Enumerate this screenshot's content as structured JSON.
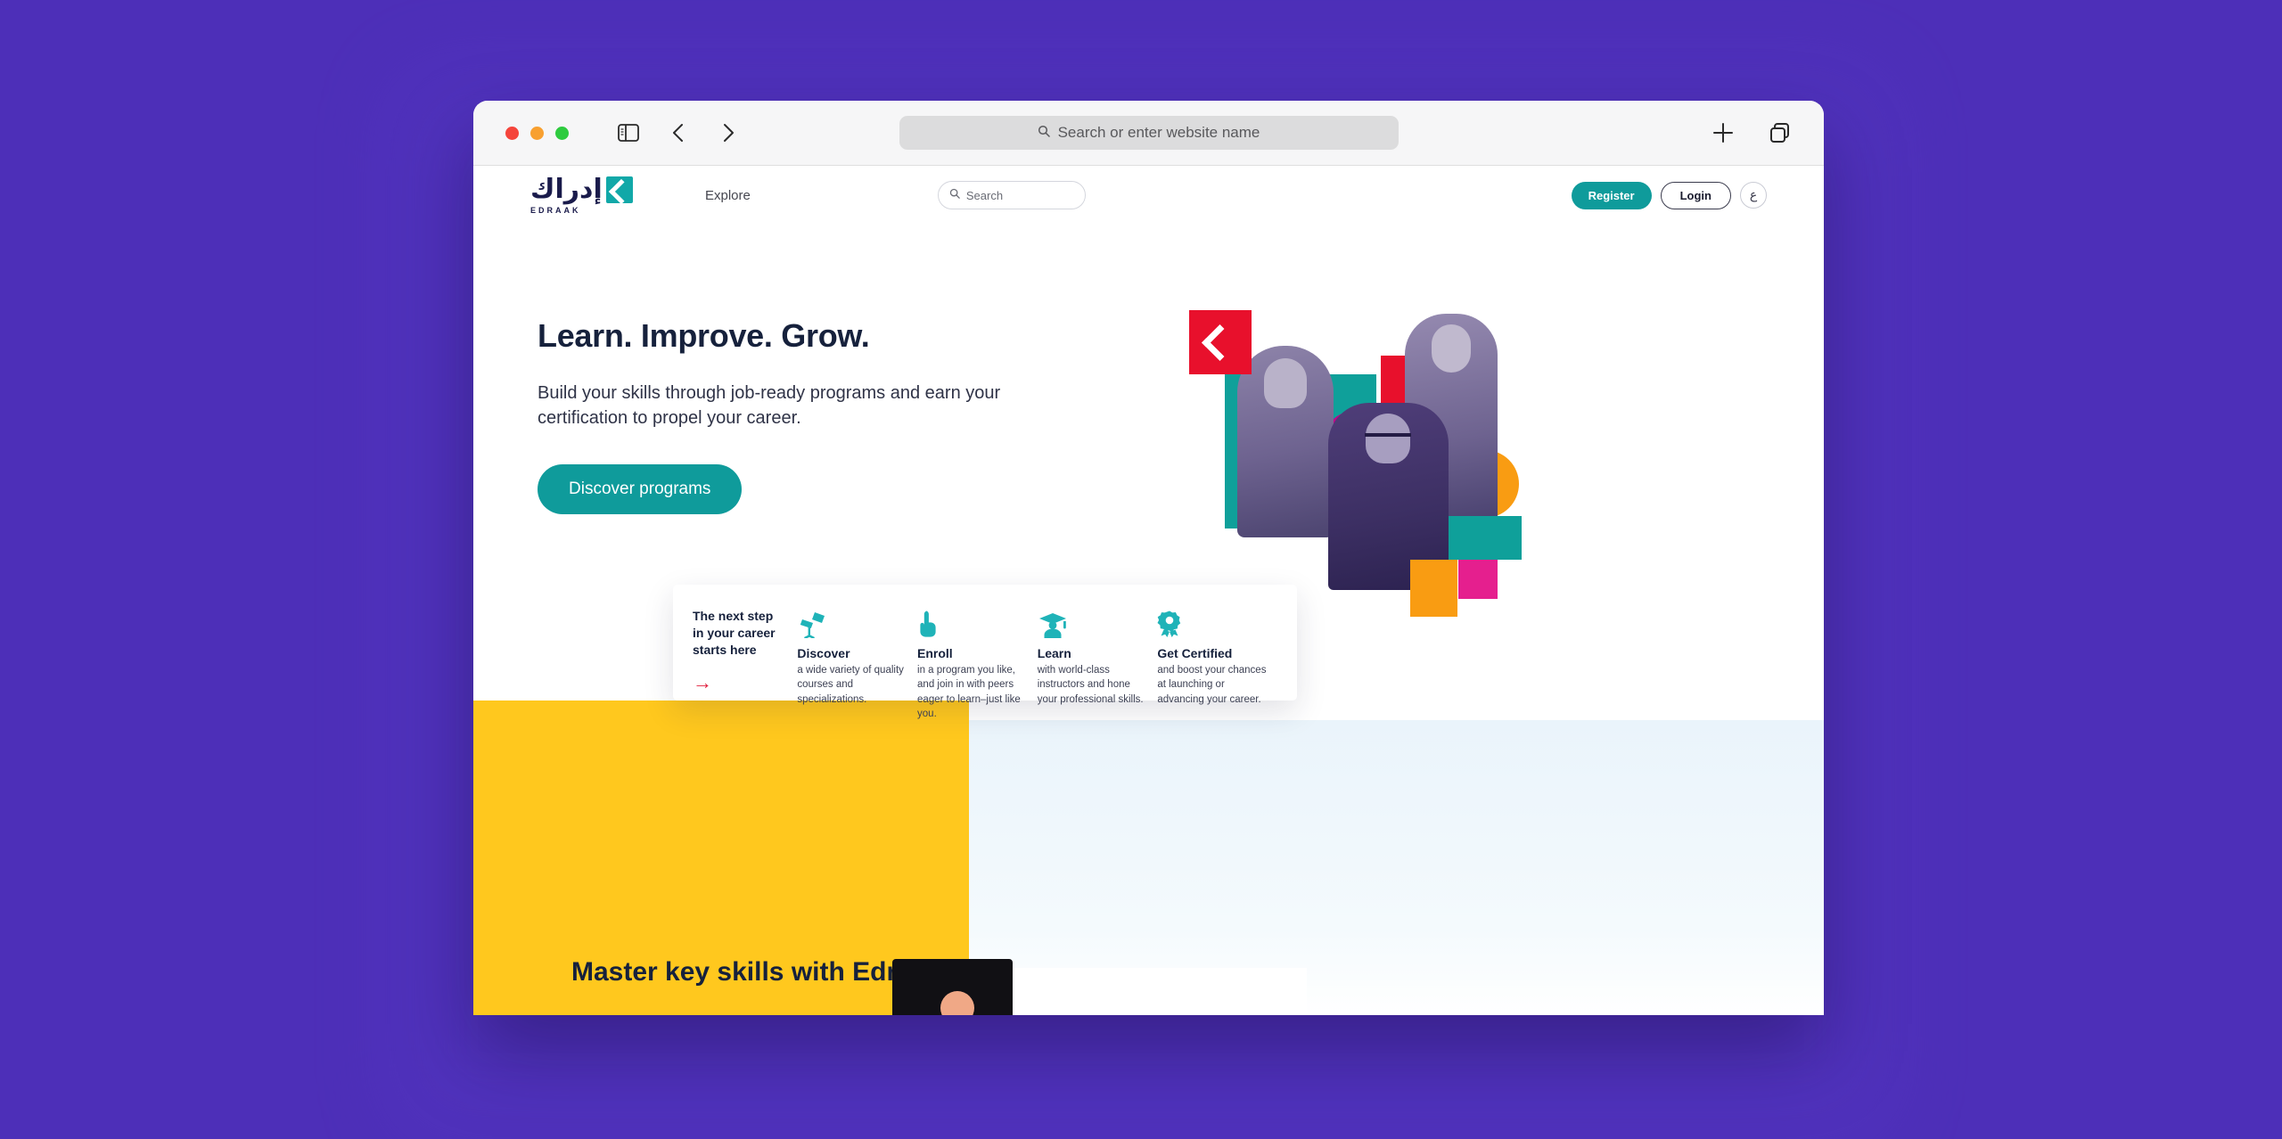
{
  "browser": {
    "traffic_lights": [
      "close",
      "minimize",
      "zoom"
    ],
    "sidebar_icon": "sidebar-toggle-icon",
    "back_icon": "chevron-left-icon",
    "forward_icon": "chevron-right-icon",
    "address_placeholder": "Search or enter website name",
    "address_search_icon": "search-icon",
    "new_tab_icon": "plus-icon",
    "tab_overview_icon": "tab-overview-icon"
  },
  "site": {
    "header": {
      "logo_arabic": "إدراك",
      "logo_wordmark": "EDRAAK",
      "nav": [
        {
          "label": "Explore"
        }
      ],
      "search_placeholder": "Search",
      "search_icon": "search-icon",
      "register_label": "Register",
      "login_label": "Login",
      "language_label": "ع"
    },
    "hero": {
      "title": "Learn. Improve. Grow.",
      "subtitle": "Build your skills through job-ready programs and earn your certification to propel your career.",
      "cta_label": "Discover programs"
    },
    "feature_card": {
      "lead_title": "The next step in your career starts here",
      "lead_arrow": "→",
      "items": [
        {
          "icon": "telescope-icon",
          "title": "Discover",
          "text": "a wide variety of quality courses and specializations."
        },
        {
          "icon": "pointing-hand-icon",
          "title": "Enroll",
          "text": "in a program you like, and join in with peers eager to learn–just like you."
        },
        {
          "icon": "graduate-icon",
          "title": "Learn",
          "text": "with world-class instructors and hone your professional skills."
        },
        {
          "icon": "award-badge-icon",
          "title": "Get Certified",
          "text": "and boost your chances at launching or advancing your career."
        }
      ]
    },
    "lower_section": {
      "title": "Master key skills with Edraak's"
    }
  },
  "colors": {
    "page_background": "#4d2fb8",
    "brand_teal": "#0f9b9b",
    "accent_red": "#e8102c",
    "accent_yellow": "#ffc81e",
    "accent_orange": "#f99c12",
    "accent_pink": "#e51f8e",
    "accent_magenta": "#c2008b",
    "text_dark": "#16213c"
  }
}
